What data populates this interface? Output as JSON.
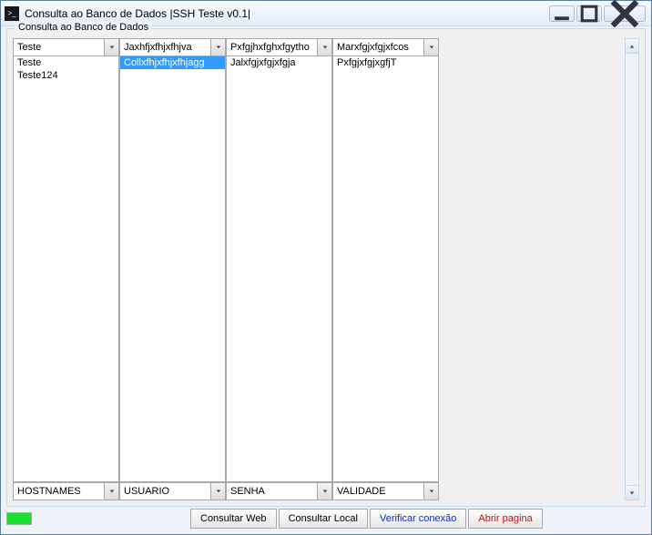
{
  "window": {
    "title": "Consulta ao Banco de Dados |SSH Teste v0.1|"
  },
  "group": {
    "title": "Consulta ao Banco de Dados"
  },
  "columns": [
    {
      "header": "Teste",
      "footer": "HOSTNAMES",
      "items": [
        "Teste",
        "Teste124"
      ],
      "selected_index": -1
    },
    {
      "header": "Jaxhfjxfhjxfhjva",
      "footer": "USUARIO",
      "items": [
        "Collxfhjxfhjxfhjagg"
      ],
      "selected_index": 0
    },
    {
      "header": "Pxfgjhxfghxfgytho",
      "footer": "SENHA",
      "items": [
        "Jalxfgjxfgjxfgja"
      ],
      "selected_index": -1
    },
    {
      "header": "Marxfgjxfgjxfcos",
      "footer": "VALIDADE",
      "items": [
        "PxfgjxfgjxgfjT"
      ],
      "selected_index": -1
    }
  ],
  "buttons": {
    "consultar_web": "Consultar Web",
    "consultar_local": "Consultar Local",
    "verificar": "Verificar conexão",
    "abrir": "Abrir pagina"
  }
}
